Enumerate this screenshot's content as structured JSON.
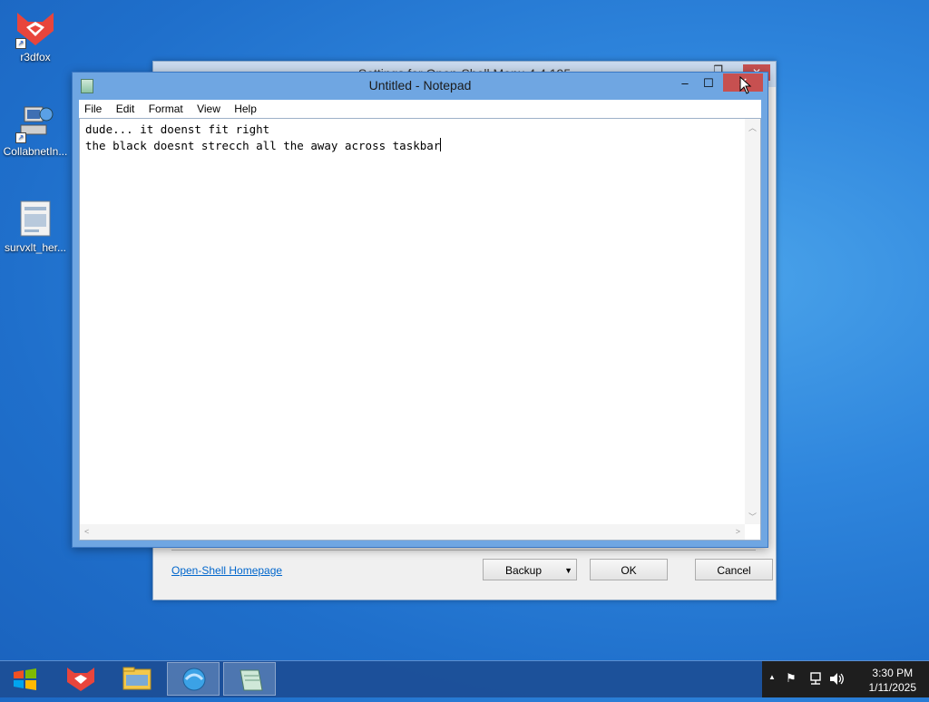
{
  "desktop": {
    "icons": [
      {
        "label": "r3dfox"
      },
      {
        "label": "CollabnetIn..."
      },
      {
        "label": "survxlt_her..."
      }
    ]
  },
  "bg_dialog": {
    "title": "Settings for Open-Shell Menu 4.4.195",
    "close_glyph": "✕",
    "max_glyph": "❐",
    "link": "Open-Shell Homepage",
    "backup_label": "Backup",
    "ok_label": "OK",
    "cancel_label": "Cancel"
  },
  "notepad": {
    "title": "Untitled - Notepad",
    "min_glyph": "–",
    "max_glyph": "☐",
    "close_glyph": "✕",
    "menu": [
      "File",
      "Edit",
      "Format",
      "View",
      "Help"
    ],
    "text_line1": "dude... it doenst fit right",
    "text_line2": "the black doesnt strecch all the away across taskbar"
  },
  "tray": {
    "time": "3:30 PM",
    "date": "1/11/2025",
    "chevron": "▲"
  },
  "colors": {
    "close_red": "#c75050",
    "taskbar": "#1c4e96",
    "tray_black": "#1e1e1e"
  }
}
